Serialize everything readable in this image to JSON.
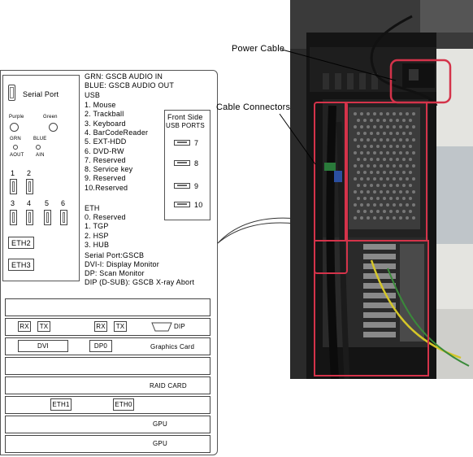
{
  "panel": {
    "serial_port_label": "Serial Port",
    "audio_labels": {
      "purple": "Purple",
      "green": "Green",
      "grn": "GRN",
      "blue": "BLUE",
      "aout": "AOUT",
      "ain": "AIN"
    },
    "usb_numbers": [
      "1",
      "2",
      "3",
      "4",
      "5",
      "6"
    ],
    "eth2": "ETH2",
    "eth3": "ETH3"
  },
  "legend": {
    "audio_in": "GRN:  GSCB AUDIO IN",
    "audio_out": "BLUE:  GSCB AUDIO OUT",
    "usb_title": "USB",
    "usb_items": [
      "1. Mouse",
      "2. Trackball",
      "3. Keyboard",
      "4. BarCodeReader",
      "5. EXT-HDD",
      "6. DVD-RW",
      "7. Reserved",
      "8. Service key",
      "9. Reserved",
      "10.Reserved"
    ],
    "eth_title": "ETH",
    "eth_items": [
      "0. Reserved",
      "1. TGP",
      "2. HSP",
      "3. HUB"
    ],
    "serial_port": "Serial Port:GSCB",
    "dvi": "DVI-I:  Display Monitor",
    "dp": "DP:  Scan Monitor",
    "dip": "DIP (D-SUB):  GSCB X-ray Abort"
  },
  "front_side": {
    "title": "Front Side",
    "subtitle": "USB PORTS",
    "ports": [
      "7",
      "8",
      "9",
      "10"
    ]
  },
  "cards": {
    "rx1": "RX",
    "tx1": "TX",
    "rx2": "RX",
    "tx2": "TX",
    "dip": "DIP",
    "dvi": "DVI",
    "dp0": "DP0",
    "graphics": "Graphics Card",
    "raid": "RAID CARD",
    "eth1": "ETH1",
    "eth0": "ETH0",
    "gpu1": "GPU",
    "gpu2": "GPU"
  },
  "photo": {
    "power_cable": "Power Cable",
    "cable_connectors": "Cable Connectors",
    "colors": {
      "highlight": "#d4334a",
      "pc_dark": "#1a1a1a"
    }
  }
}
